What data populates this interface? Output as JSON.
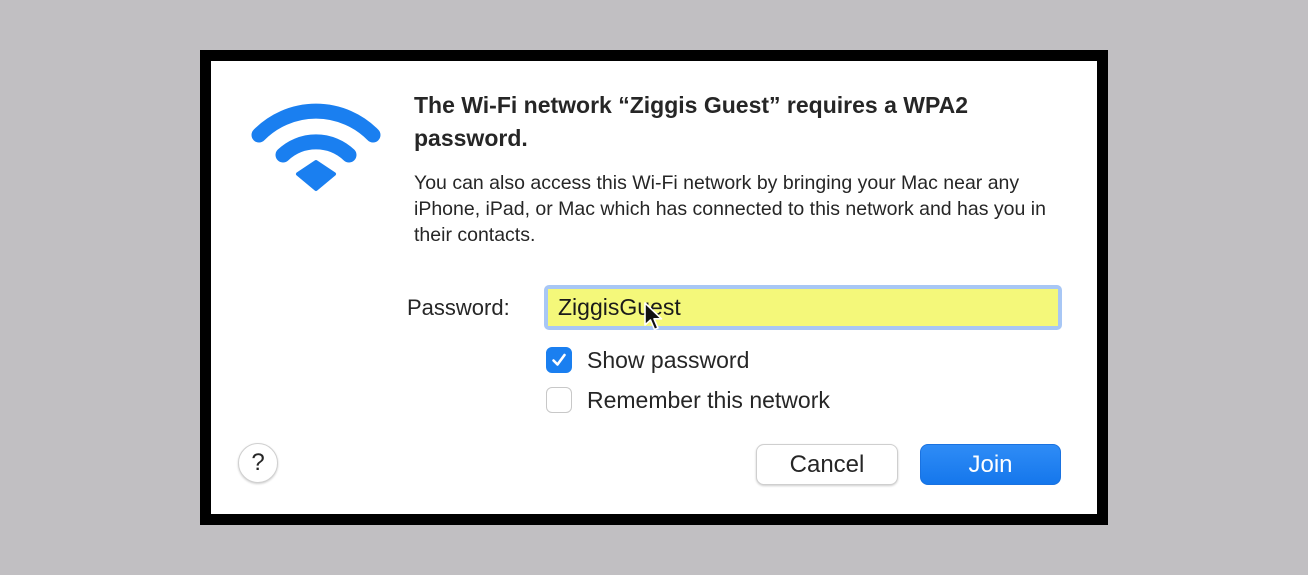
{
  "dialog": {
    "title": "The Wi-Fi network “Ziggis Guest” requires a WPA2 password.",
    "description": "You can also access this Wi-Fi network by bringing your Mac near any iPhone, iPad, or Mac which has connected to this network and has you in their contacts.",
    "icon": "wifi-icon",
    "accent_color": "#1a7ff0"
  },
  "password": {
    "label": "Password:",
    "value": "ZiggisGuest",
    "field_color": "#f4f87a"
  },
  "options": {
    "show_password": {
      "label": "Show password",
      "checked": true
    },
    "remember_network": {
      "label": "Remember this network",
      "checked": false
    }
  },
  "buttons": {
    "help_label": "?",
    "cancel_label": "Cancel",
    "join_label": "Join"
  }
}
